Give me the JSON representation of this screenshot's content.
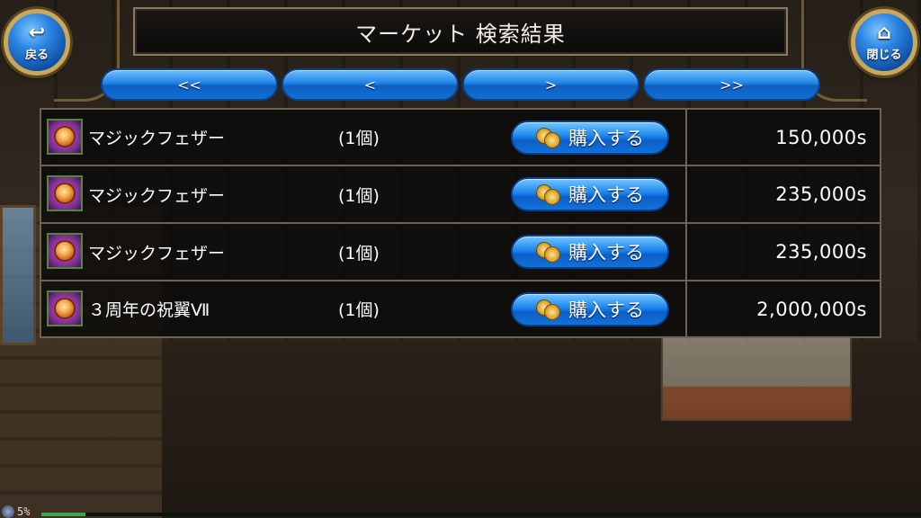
{
  "header": {
    "title": "マーケット 検索結果",
    "back_label": "戻る",
    "close_label": "閉じる"
  },
  "pager": {
    "first": "<<",
    "prev": "<",
    "next": ">",
    "last": ">>"
  },
  "results": [
    {
      "name": "マジックフェザー",
      "qty": "(1個)",
      "buy_label": "購入する",
      "price": "150,000s",
      "icon": "magic-feather-icon"
    },
    {
      "name": "マジックフェザー",
      "qty": "(1個)",
      "buy_label": "購入する",
      "price": "235,000s",
      "icon": "magic-feather-icon"
    },
    {
      "name": "マジックフェザー",
      "qty": "(1個)",
      "buy_label": "購入する",
      "price": "235,000s",
      "icon": "magic-feather-icon"
    },
    {
      "name": "３周年の祝翼Ⅶ",
      "qty": "(1個)",
      "buy_label": "購入する",
      "price": "2,000,000s",
      "icon": "anniversary-wing-icon"
    }
  ],
  "status": {
    "percent_text": "5%",
    "progress": 0.05
  },
  "colors": {
    "button_blue": "#1f83e6",
    "frame_gold": "#c9a85c",
    "row_bg": "#0a0a0a"
  }
}
